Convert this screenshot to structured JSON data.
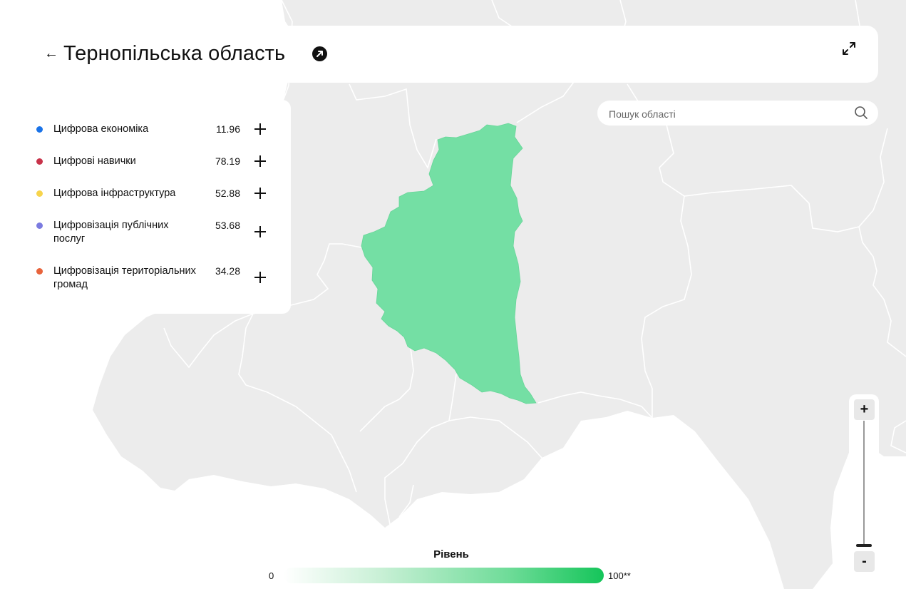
{
  "header": {
    "back_icon": "arrow-left-icon",
    "title": "Тернопільська область",
    "external_link_icon": "arrow-up-right-circle-icon",
    "fullscreen_icon": "expand-arrows-icon"
  },
  "search": {
    "placeholder": "Пошук області",
    "value": "",
    "icon": "search-icon"
  },
  "indicators": [
    {
      "label": "Цифрова економіка",
      "value": "11.96",
      "color": "#1a73e8"
    },
    {
      "label": "Цифрові навички",
      "value": "78.19",
      "color": "#c8334a"
    },
    {
      "label": "Цифрова інфраструктура",
      "value": "52.88",
      "color": "#f7d44c"
    },
    {
      "label": "Цифровізація публічних послуг",
      "value": "53.68",
      "color": "#7b7be0"
    },
    {
      "label": "Цифровізація територіальних громад",
      "value": "34.28",
      "color": "#e8643c"
    }
  ],
  "map": {
    "highlighted_region": "Тернопільська область",
    "highlight_color": "#74dfa4",
    "land_color": "#ececec",
    "border_color": "#ffffff"
  },
  "zoom": {
    "zoom_in_label": "+",
    "zoom_out_label": "-"
  },
  "legend": {
    "title": "Рівень",
    "min_label": "0",
    "max_label": "100**",
    "gradient_start": "#ffffff",
    "gradient_end": "#15c55a"
  }
}
